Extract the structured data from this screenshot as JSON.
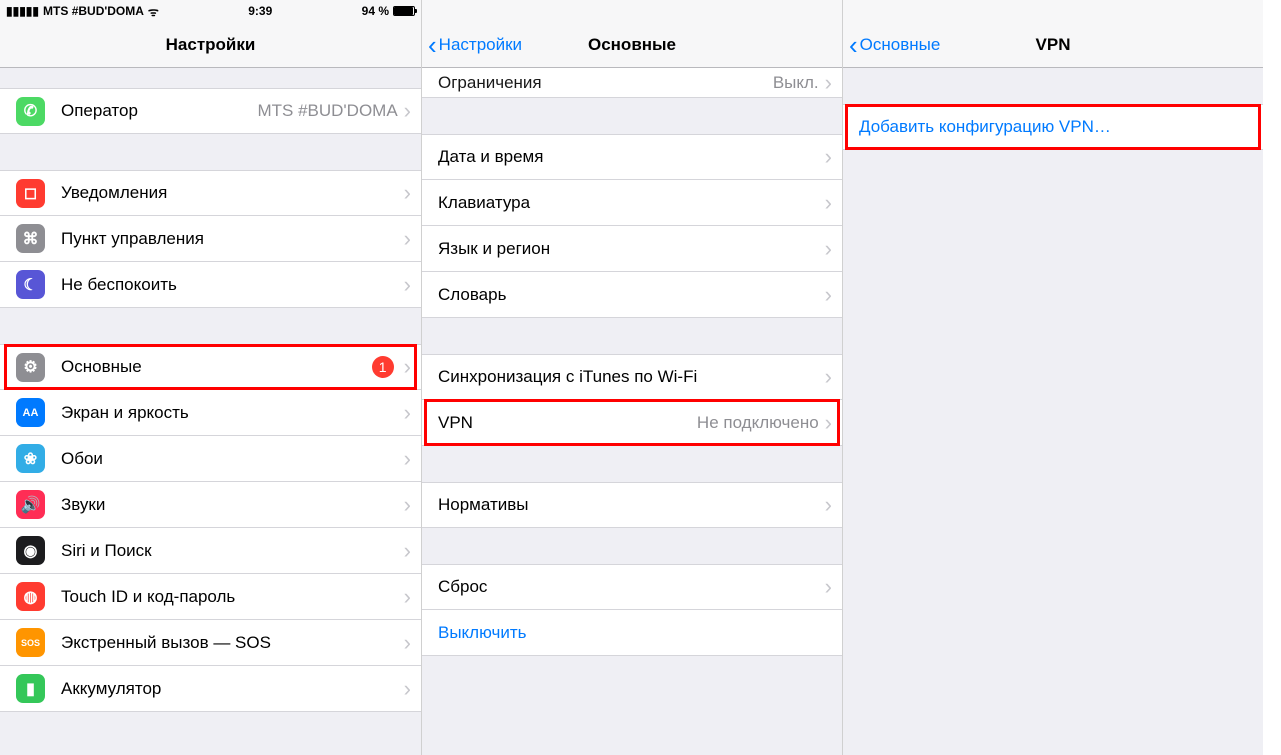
{
  "pane1": {
    "status": {
      "signal": "▮▮▮▮▮",
      "carrier": "MTS #BUD'DOMA",
      "wifi": "ᯤ",
      "time": "9:39",
      "battery_pct": "94 %"
    },
    "title": "Настройки",
    "group1": [
      {
        "icon_name": "phone-icon",
        "icon_bg": "bg-green",
        "glyph": "✆",
        "label": "Оператор",
        "detail": "MTS #BUD'DOMA"
      }
    ],
    "group2": [
      {
        "icon_name": "notifications-icon",
        "icon_bg": "bg-red",
        "glyph": "◻",
        "label": "Уведомления"
      },
      {
        "icon_name": "control-center-icon",
        "icon_bg": "bg-gray",
        "glyph": "⌘",
        "label": "Пункт управления"
      },
      {
        "icon_name": "dnd-icon",
        "icon_bg": "bg-purple",
        "glyph": "☾",
        "label": "Не беспокоить"
      }
    ],
    "group3": [
      {
        "icon_name": "general-icon",
        "icon_bg": "bg-gray",
        "glyph": "⚙",
        "label": "Основные",
        "badge": "1",
        "highlight": true
      },
      {
        "icon_name": "display-icon",
        "icon_bg": "bg-blue",
        "glyph": "AA",
        "label": "Экран и яркость"
      },
      {
        "icon_name": "wallpaper-icon",
        "icon_bg": "bg-cyan",
        "glyph": "❀",
        "label": "Обои"
      },
      {
        "icon_name": "sounds-icon",
        "icon_bg": "bg-pink",
        "glyph": "🔊",
        "label": "Звуки"
      },
      {
        "icon_name": "siri-icon",
        "icon_bg": "bg-black",
        "glyph": "◉",
        "label": "Siri и Поиск"
      },
      {
        "icon_name": "touchid-icon",
        "icon_bg": "bg-red",
        "glyph": "◍",
        "label": "Touch ID и код-пароль"
      },
      {
        "icon_name": "sos-icon",
        "icon_bg": "bg-orange",
        "glyph": "SOS",
        "label": "Экстренный вызов — SOS"
      },
      {
        "icon_name": "battery-icon",
        "icon_bg": "bg-lgreen",
        "glyph": "▮",
        "label": "Аккумулятор"
      }
    ]
  },
  "pane2": {
    "back": "Настройки",
    "title": "Основные",
    "cut_label": "Ограничения",
    "cut_detail": "Выкл.",
    "groupA": [
      {
        "label": "Дата и время"
      },
      {
        "label": "Клавиатура"
      },
      {
        "label": "Язык и регион"
      },
      {
        "label": "Словарь"
      }
    ],
    "groupB": [
      {
        "label": "Синхронизация с iTunes по Wi-Fi"
      },
      {
        "label": "VPN",
        "detail": "Не подключено",
        "highlight": true
      }
    ],
    "groupC": [
      {
        "label": "Нормативы"
      }
    ],
    "groupD": [
      {
        "label": "Сброс"
      },
      {
        "label": "Выключить",
        "link": true,
        "noarrow": true
      }
    ]
  },
  "pane3": {
    "back": "Основные",
    "title": "VPN",
    "rows": [
      {
        "label": "Добавить конфигурацию VPN…",
        "link": true,
        "noarrow": true,
        "highlight": true
      }
    ]
  }
}
